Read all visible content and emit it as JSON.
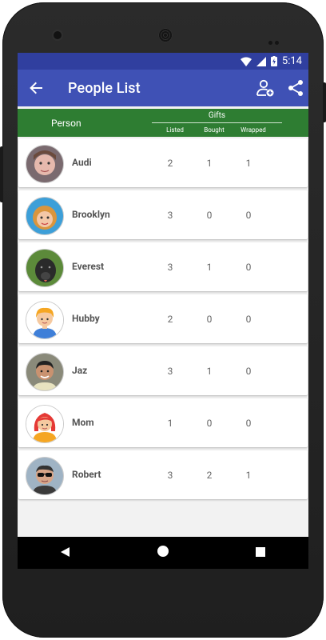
{
  "status": {
    "time": "5:14"
  },
  "toolbar": {
    "title": "People List"
  },
  "table_header": {
    "person": "Person",
    "gifts": "Gifts",
    "cols": [
      "Listed",
      "Bought",
      "Wrapped"
    ]
  },
  "people": [
    {
      "name": "Audi",
      "listed": "2",
      "bought": "1",
      "wrapped": "1",
      "avatar": "toddler-photo"
    },
    {
      "name": "Brooklyn",
      "listed": "3",
      "bought": "0",
      "wrapped": "0",
      "avatar": "girl-photo"
    },
    {
      "name": "Everest",
      "listed": "3",
      "bought": "1",
      "wrapped": "0",
      "avatar": "dog-photo"
    },
    {
      "name": "Hubby",
      "listed": "2",
      "bought": "0",
      "wrapped": "0",
      "avatar": "cartoon-man"
    },
    {
      "name": "Jaz",
      "listed": "3",
      "bought": "1",
      "wrapped": "0",
      "avatar": "man-photo"
    },
    {
      "name": "Mom",
      "listed": "1",
      "bought": "0",
      "wrapped": "0",
      "avatar": "cartoon-woman"
    },
    {
      "name": "Robert",
      "listed": "3",
      "bought": "2",
      "wrapped": "1",
      "avatar": "sunglasses-photo"
    }
  ],
  "colors": {
    "statusbar": "#303f9f",
    "toolbar": "#3f51b5",
    "header": "#2e7d32"
  }
}
